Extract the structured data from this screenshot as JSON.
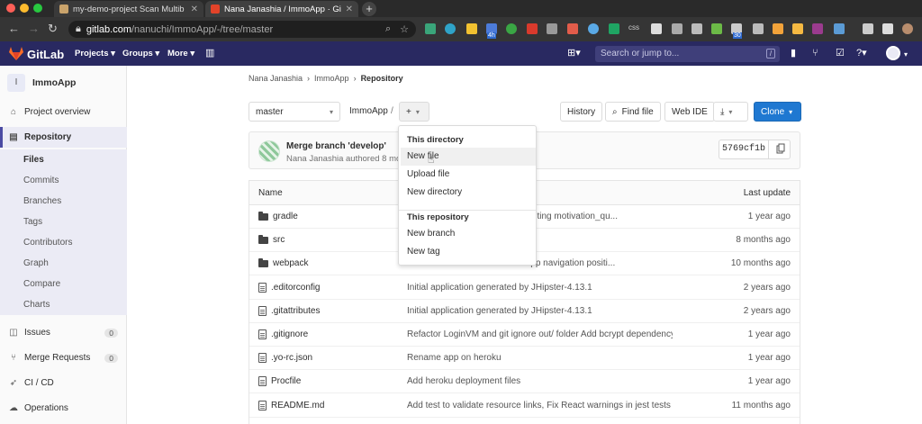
{
  "browser": {
    "tabs": [
      {
        "title": "my-demo-project Scan Multib",
        "active": false
      },
      {
        "title": "Nana Janashia / ImmoApp · Gi",
        "active": true
      }
    ],
    "url_host": "gitlab.com",
    "url_path": "/nanuchi/ImmoApp/-/tree/master",
    "ext_labels": {
      "css": "css",
      "badge": "4h",
      "count": "30"
    }
  },
  "gitlab_header": {
    "brand": "GitLab",
    "nav": [
      "Projects",
      "Groups",
      "More"
    ],
    "search_placeholder": "Search or jump to...",
    "search_shortcut": "/"
  },
  "sidebar": {
    "project_initial": "I",
    "project_name": "ImmoApp",
    "items": [
      {
        "label": "Project overview",
        "icon": "home-icon"
      },
      {
        "label": "Repository",
        "icon": "book-icon",
        "active": true
      },
      {
        "label": "Issues",
        "icon": "issues-icon",
        "count": "0"
      },
      {
        "label": "Merge Requests",
        "icon": "merge-request-icon",
        "count": "0"
      },
      {
        "label": "CI / CD",
        "icon": "rocket-icon"
      },
      {
        "label": "Operations",
        "icon": "cloud-icon"
      }
    ],
    "repo_subitems": [
      "Files",
      "Commits",
      "Branches",
      "Tags",
      "Contributors",
      "Graph",
      "Compare",
      "Charts"
    ]
  },
  "breadcrumb": [
    "Nana Janashia",
    "ImmoApp",
    "Repository"
  ],
  "toolbar": {
    "branch": "master",
    "path_root": "ImmoApp",
    "path_sep": "/",
    "add_label": "+",
    "history": "History",
    "find_file": "Find file",
    "web_ide": "Web IDE",
    "clone": "Clone"
  },
  "last_commit": {
    "title": "Merge branch 'develop'",
    "author_line": "Nana Janashia authored 8 mo",
    "sha": "5769cf1b"
  },
  "files_table": {
    "headers": {
      "name": "Name",
      "last_update": "Last update"
    },
    "rows": [
      {
        "name": "gradle",
        "type": "folder",
        "message": "t db and fix writing motivation_qu...",
        "time": "1 year ago"
      },
      {
        "name": "src",
        "type": "folder",
        "message": "",
        "time": "8 months ago"
      },
      {
        "name": "webpack",
        "type": "folder",
        "message": "one and fix app navigation positi...",
        "time": "10 months ago"
      },
      {
        "name": ".editorconfig",
        "type": "file",
        "message": "Initial application generated by JHipster-4.13.1",
        "time": "2 years ago"
      },
      {
        "name": ".gitattributes",
        "type": "file",
        "message": "Initial application generated by JHipster-4.13.1",
        "time": "2 years ago"
      },
      {
        "name": ".gitignore",
        "type": "file",
        "message": "Refactor LoginVM and git ignore out/ folder Add bcrypt dependency...",
        "time": "1 year ago"
      },
      {
        "name": ".yo-rc.json",
        "type": "file",
        "message": "Rename app on heroku",
        "time": "1 year ago"
      },
      {
        "name": "Procfile",
        "type": "file",
        "message": "Add heroku deployment files",
        "time": "1 year ago"
      },
      {
        "name": "README.md",
        "type": "file",
        "message": "Add test to validate resource links, Fix React warnings in jest tests C...",
        "time": "11 months ago"
      }
    ]
  },
  "add_dropdown": {
    "section1": "This directory",
    "dir_items": [
      "New file",
      "Upload file",
      "New directory"
    ],
    "section2": "This repository",
    "repo_items": [
      "New branch",
      "New tag"
    ]
  },
  "colors": {
    "header": "#292961",
    "primary": "#1f78d1",
    "active_sidebar": "#4b4ba3"
  }
}
